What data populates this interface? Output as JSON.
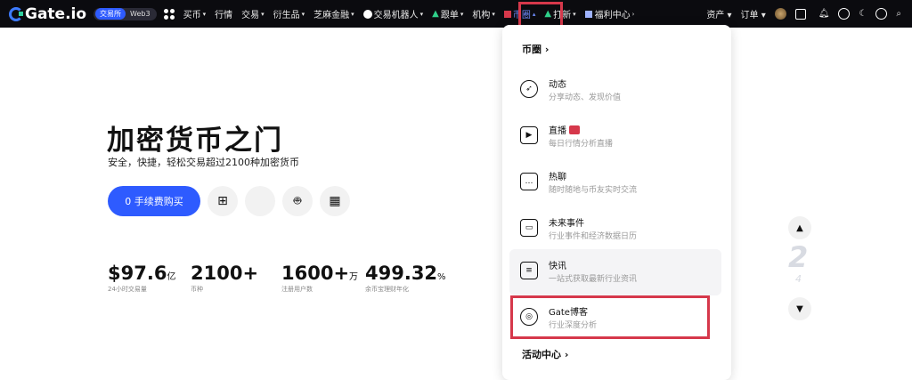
{
  "topbar": {
    "logo": "Gate.io",
    "segment": [
      "交易所",
      "Web3"
    ],
    "nav": [
      {
        "label": "买币",
        "caret": "▾"
      },
      {
        "label": "行情",
        "caret": ""
      },
      {
        "label": "交易",
        "caret": "▾"
      },
      {
        "label": "衍生品",
        "caret": "▾"
      },
      {
        "label": "芝麻金融",
        "caret": "▾"
      },
      {
        "label": "交易机器人",
        "caret": "▾"
      },
      {
        "label": "跟单",
        "caret": "▾"
      },
      {
        "label": "机构",
        "caret": "▾"
      },
      {
        "label": "币圈",
        "caret": "▴"
      },
      {
        "label": "打新",
        "caret": "▾"
      },
      {
        "label": "福利中心",
        "caret": "›"
      }
    ],
    "right": {
      "assets": "资产 ▾",
      "orders": "订单 ▾"
    }
  },
  "hero": {
    "title": "加密货币之门",
    "subtitle": "安全，快捷，轻松交易超过2100种加密货币",
    "cta": "0 手续费购买",
    "os_icons": [
      "windows-icon",
      "apple-icon",
      "android-icon",
      "qrcode-icon"
    ],
    "stats": [
      {
        "value": "$97.6",
        "unit": "亿",
        "label": "24小时交易量"
      },
      {
        "value": "2100+",
        "unit": "",
        "label": "币种"
      },
      {
        "value": "1600+",
        "unit": "万",
        "label": "注册用户数"
      },
      {
        "value": "499.32",
        "unit": "%",
        "label": "余币宝理财年化"
      }
    ]
  },
  "menu": {
    "header": "币圈 ›",
    "items": [
      {
        "title": "动态",
        "desc": "分享动态、发现价值",
        "icon": "compass-icon"
      },
      {
        "title": "直播",
        "desc": "每日行情分析直播",
        "icon": "live-tv-icon"
      },
      {
        "title": "热聊",
        "desc": "随时随地与币友实时交流",
        "icon": "chat-icon"
      },
      {
        "title": "未来事件",
        "desc": "行业事件和经济数据日历",
        "icon": "calendar-icon"
      },
      {
        "title": "快讯",
        "desc": "一站式获取最新行业资讯",
        "icon": "news-icon"
      },
      {
        "title": "Gate博客",
        "desc": "行业深度分析",
        "icon": "blog-icon"
      }
    ],
    "footer": "活动中心 ›"
  },
  "carousel": {
    "page": "2",
    "next": "4"
  }
}
